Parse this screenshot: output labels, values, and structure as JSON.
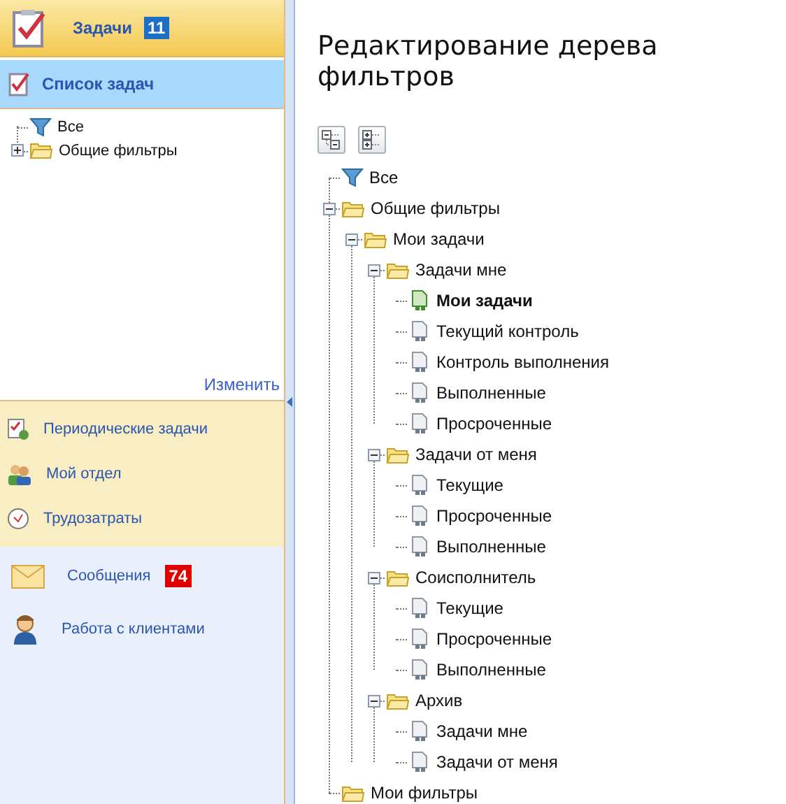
{
  "sidebar": {
    "header": {
      "title": "Задачи",
      "badge": "11"
    },
    "section": {
      "title": "Список задач"
    },
    "tree": [
      {
        "label": "Все",
        "kind": "filter",
        "selected": false
      },
      {
        "label": "Общие фильтры",
        "kind": "folder",
        "selected": false,
        "expanded": false
      }
    ],
    "edit_link": "Изменить",
    "nav_items": [
      {
        "label": "Периодические задачи",
        "kind": "recurring"
      },
      {
        "label": "Мой отдел",
        "kind": "department"
      },
      {
        "label": "Трудозатраты",
        "kind": "clock"
      }
    ],
    "modules": [
      {
        "label": "Сообщения",
        "kind": "mail",
        "badge": "74"
      },
      {
        "label": "Работа с клиентами",
        "kind": "person"
      }
    ]
  },
  "editor": {
    "title": "Редактирование дерева фильтров",
    "tree": [
      {
        "label": "Все",
        "kind": "filter",
        "selected": false
      },
      {
        "label": "Общие фильтры",
        "kind": "folder",
        "selected": false,
        "expanded": true,
        "children": [
          {
            "label": "Мои задачи",
            "kind": "folder",
            "selected": false,
            "expanded": true,
            "children": [
              {
                "label": "Задачи мне",
                "kind": "folder",
                "selected": false,
                "expanded": true,
                "children": [
                  {
                    "label": "Мои задачи",
                    "kind": "item",
                    "selected": true
                  },
                  {
                    "label": "Текущий контроль",
                    "kind": "item",
                    "selected": false
                  },
                  {
                    "label": "Контроль выполнения",
                    "kind": "item",
                    "selected": false
                  },
                  {
                    "label": "Выполненные",
                    "kind": "item",
                    "selected": false
                  },
                  {
                    "label": "Просроченные",
                    "kind": "item",
                    "selected": false
                  }
                ]
              },
              {
                "label": "Задачи от меня",
                "kind": "folder",
                "selected": false,
                "expanded": true,
                "children": [
                  {
                    "label": "Текущие",
                    "kind": "item",
                    "selected": false
                  },
                  {
                    "label": "Просроченные",
                    "kind": "item",
                    "selected": false
                  },
                  {
                    "label": "Выполненные",
                    "kind": "item",
                    "selected": false
                  }
                ]
              },
              {
                "label": "Соисполнитель",
                "kind": "folder",
                "selected": false,
                "expanded": true,
                "children": [
                  {
                    "label": "Текущие",
                    "kind": "item",
                    "selected": false
                  },
                  {
                    "label": "Просроченные",
                    "kind": "item",
                    "selected": false
                  },
                  {
                    "label": "Выполненные",
                    "kind": "item",
                    "selected": false
                  }
                ]
              },
              {
                "label": "Архив",
                "kind": "folder",
                "selected": false,
                "expanded": true,
                "children": [
                  {
                    "label": "Задачи мне",
                    "kind": "item",
                    "selected": false
                  },
                  {
                    "label": "Задачи от меня",
                    "kind": "item",
                    "selected": false
                  }
                ]
              }
            ]
          }
        ]
      },
      {
        "label": "Мои фильтры",
        "kind": "folder",
        "selected": false
      }
    ]
  }
}
